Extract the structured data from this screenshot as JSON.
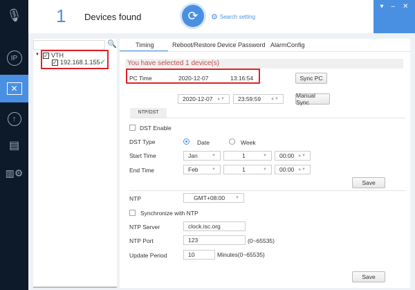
{
  "header": {
    "count": "1",
    "title": "Devices found",
    "search_setting": "Search setting"
  },
  "window": {
    "menu": "▾",
    "minimize": "–",
    "close": "✕"
  },
  "sidebar": {
    "items": [
      {
        "icon": "microphone-icon"
      },
      {
        "icon": "ip-icon"
      },
      {
        "icon": "tools-icon",
        "active": true
      },
      {
        "icon": "upgrade-icon"
      },
      {
        "icon": "document-icon"
      },
      {
        "icon": "building-settings-icon"
      }
    ]
  },
  "tree": {
    "root": "VTH",
    "device": "192.168.1.155",
    "search_placeholder": ""
  },
  "tabs": [
    "Timing",
    "Reboot/Restore",
    "Device Password",
    "AlarmConfig"
  ],
  "timing": {
    "selected_msg": "You have selected 1 device(s)",
    "pc_time_label": "PC Time",
    "pc_date": "2020-12-07",
    "pc_time": "13:16:54",
    "sync_pc": "Sync PC",
    "manual_date": "2020-12-07",
    "manual_time": "23:59:59",
    "manual_sync": "Manual Sync",
    "subtab": "NTP/DST",
    "dst_enable": "DST Enable",
    "dst_type": "DST Type",
    "date": "Date",
    "week": "Week",
    "start_time": "Start Time",
    "start_month": "Jan",
    "start_day": "1",
    "start_clock": "00:00",
    "end_time": "End Time",
    "end_month": "Feb",
    "end_day": "1",
    "end_clock": "00:00",
    "save": "Save",
    "ntp": "NTP",
    "timezone": "GMT+08:00",
    "sync_ntp": "Synchronize with NTP",
    "ntp_server_label": "NTP Server",
    "ntp_server": "clock.isc.org",
    "ntp_port_label": "NTP Port",
    "ntp_port": "123",
    "port_range": "(0~65535)",
    "update_label": "Update Period",
    "update_value": "10",
    "update_range": "Minutes(0~65535)"
  },
  "colors": {
    "accent": "#4a90e2",
    "sidebar": "#0d1a2a",
    "highlight": "#e0202a",
    "message": "#c0504d"
  }
}
